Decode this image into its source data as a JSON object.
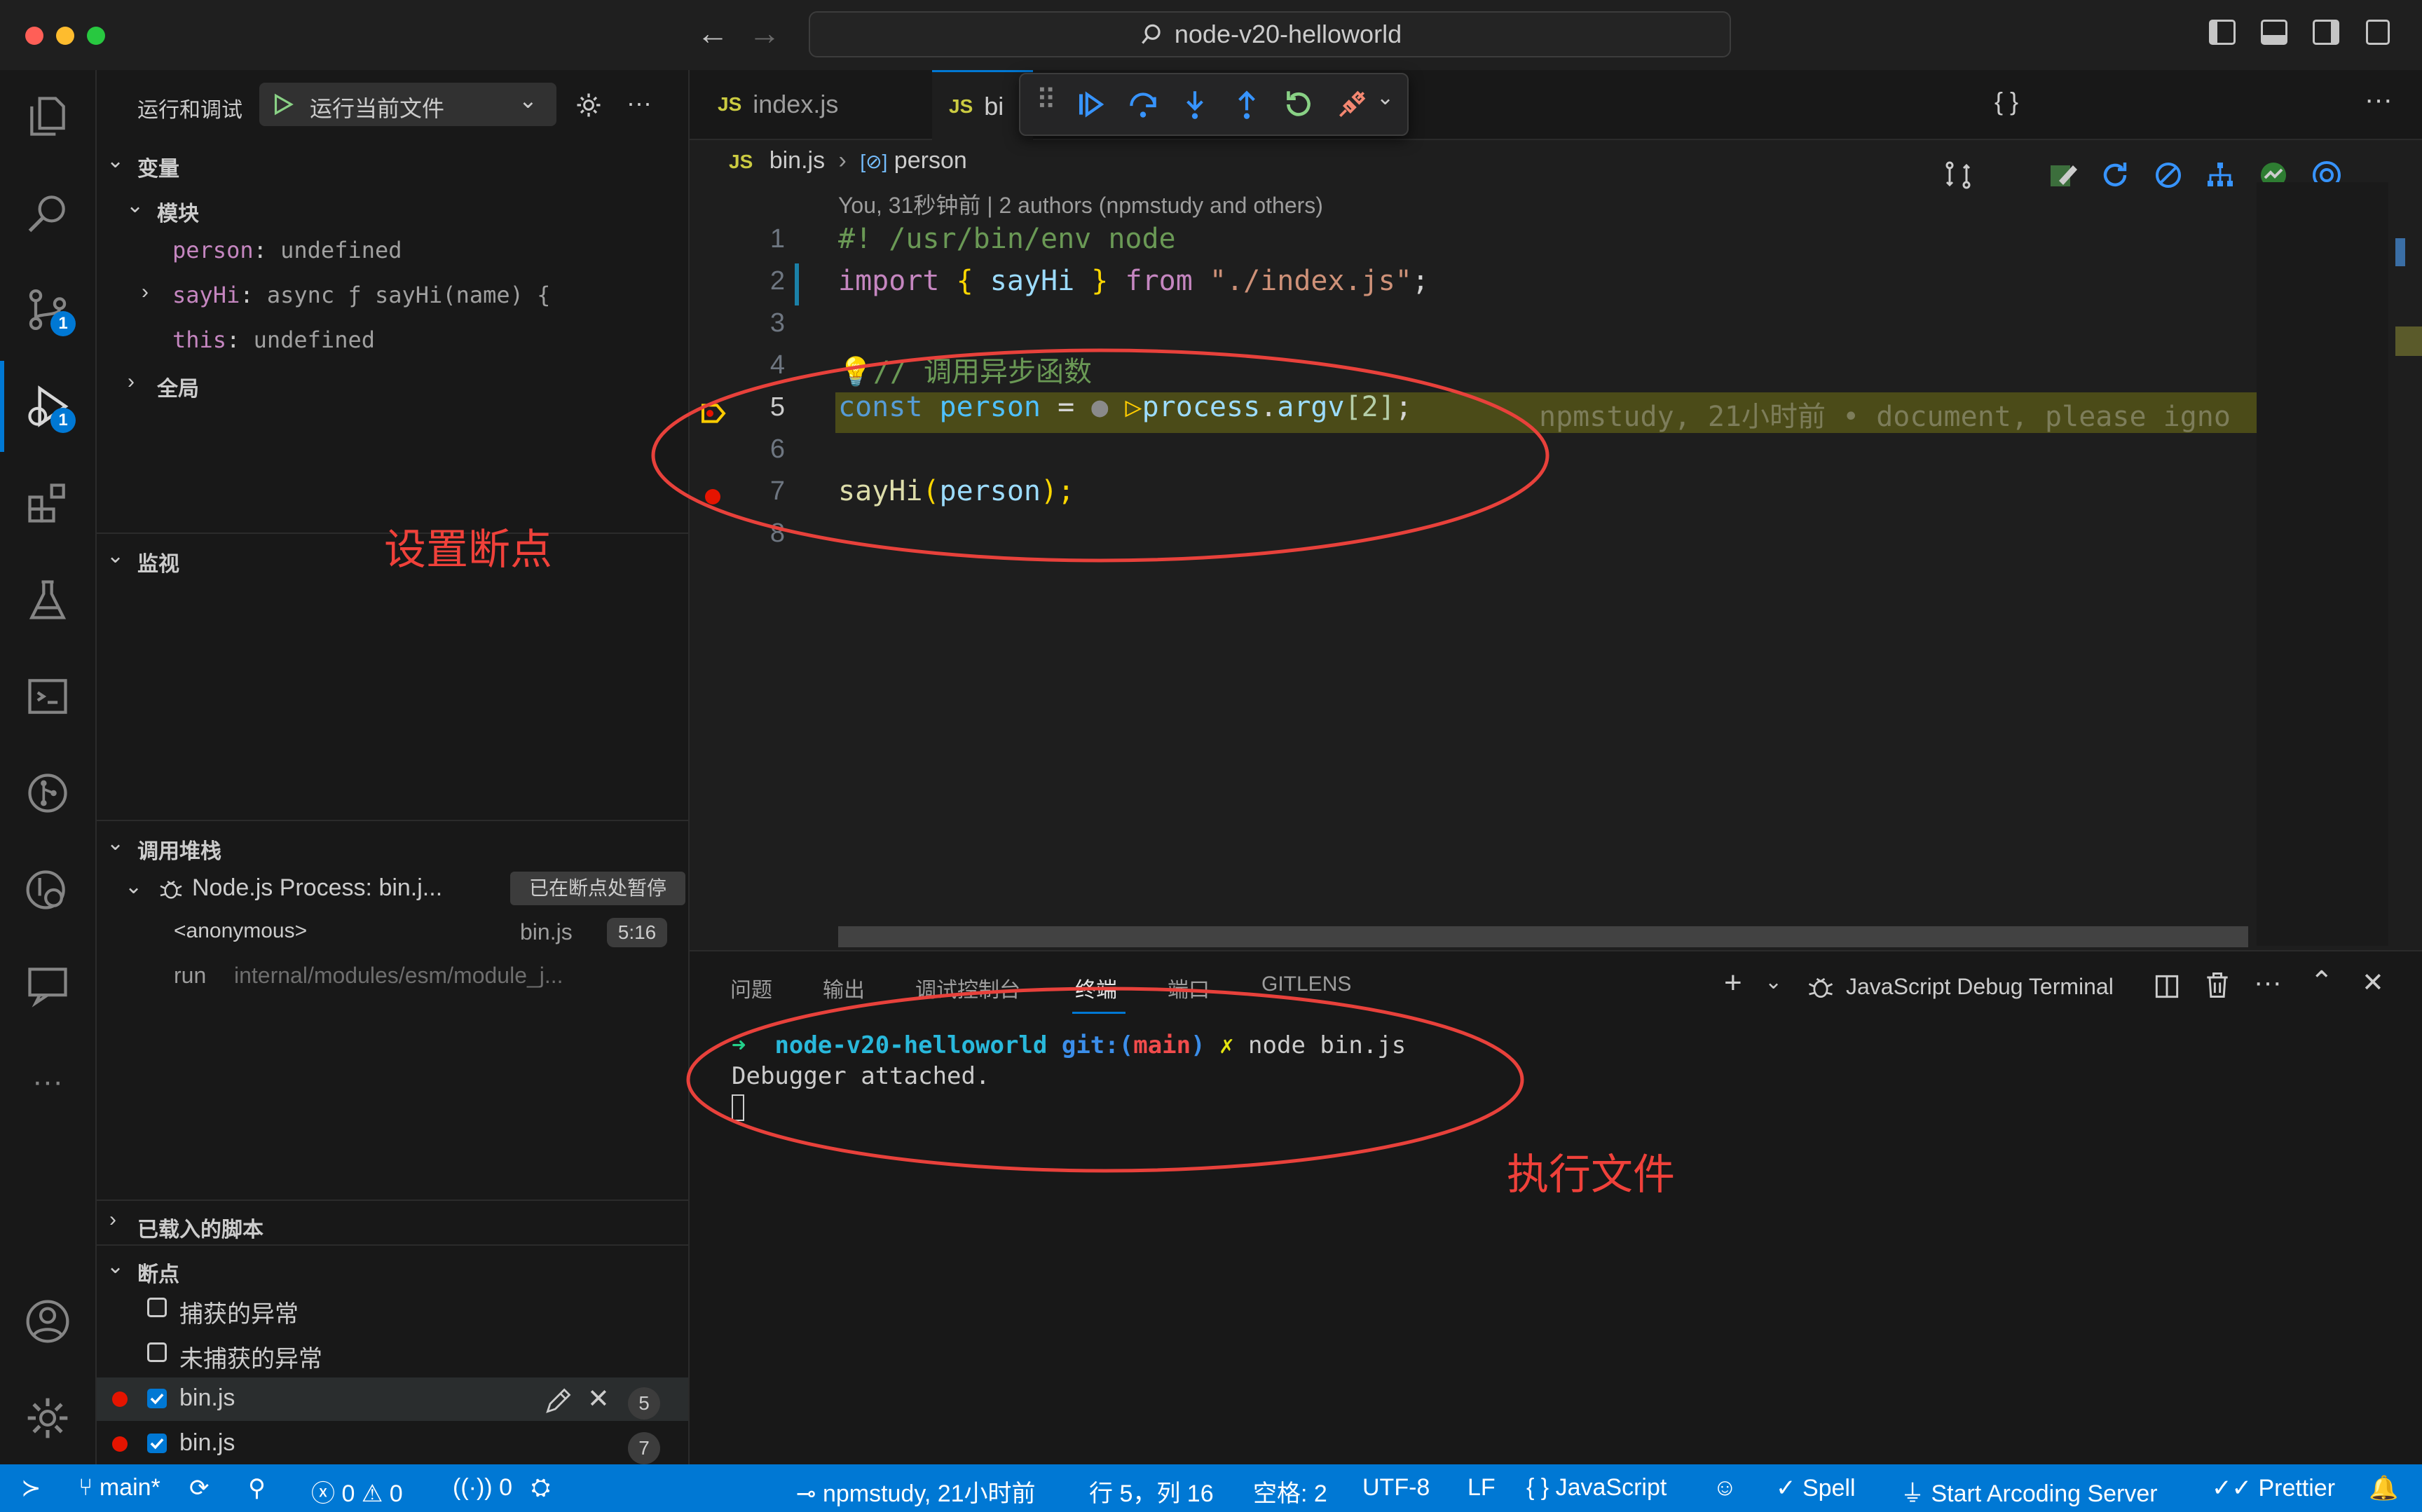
{
  "window": {
    "title": "node-v20-helloworld"
  },
  "sidebar": {
    "header": "运行和调试",
    "run_config": "运行当前文件",
    "variables": {
      "title": "变量",
      "module_group": "模块",
      "items": [
        {
          "name": "person",
          "value": "undefined"
        },
        {
          "name": "sayHi",
          "value": "async ƒ sayHi(name) {"
        },
        {
          "name": "this",
          "value": "undefined"
        }
      ],
      "global_group": "全局"
    },
    "watch_title": "监视",
    "call_stack": {
      "title": "调用堆栈",
      "process": "Node.js Process: bin.j...",
      "paused_badge": "已在断点处暂停",
      "frames": [
        {
          "name": "<anonymous>",
          "file": "bin.js",
          "pos": "5:16"
        },
        {
          "name": "run",
          "file": "internal/modules/esm/module_j..."
        }
      ]
    },
    "loaded_scripts_title": "已载入的脚本",
    "breakpoints": {
      "title": "断点",
      "caught": "捕获的异常",
      "uncaught": "未捕获的异常",
      "items": [
        {
          "file": "bin.js",
          "line": "5"
        },
        {
          "file": "bin.js",
          "line": "7"
        }
      ]
    }
  },
  "editor": {
    "tabs": [
      {
        "label": "index.js"
      },
      {
        "label": "bi"
      }
    ],
    "breadcrumb": {
      "file": "bin.js",
      "symbol": "person"
    },
    "blame_header": "You, 31秒钟前 | 2 authors (npmstudy and others)",
    "line_numbers": [
      "1",
      "2",
      "3",
      "4",
      "5",
      "6",
      "7",
      "8"
    ],
    "code": {
      "l1": "#! /usr/bin/env node",
      "l2_import": "import",
      "l2_open": "{",
      "l2_name": "sayHi",
      "l2_close": "}",
      "l2_from": "from",
      "l2_path": "\"./index.js\"",
      "l2_semi": ";",
      "l4_comment": "// 调用异步函数",
      "l5_const": "const",
      "l5_var": "person",
      "l5_eq": "=",
      "l5_obj": "process",
      "l5_prop": "argv",
      "l5_idx": "[2]",
      "l5_semi": ";",
      "l7_fn": "sayHi",
      "l7_arg": "person",
      "l7_tail": ");"
    },
    "inline_blame": "npmstudy, 21小时前 • document, please igno"
  },
  "panel": {
    "tabs": [
      "问题",
      "输出",
      "调试控制台",
      "终端",
      "端口",
      "GITLENS"
    ],
    "active_tab": "终端",
    "terminal_name": "JavaScript Debug Terminal",
    "prompt_arrow": "➜",
    "prompt_dir": "node-v20-helloworld",
    "prompt_git": "git:(",
    "prompt_branch": "main",
    "prompt_git_close": ")",
    "prompt_x": "✗",
    "command": "node bin.js",
    "output": "Debugger attached."
  },
  "statusbar": {
    "branch": "main*",
    "errors": "0",
    "warnings": "0",
    "ports": "0",
    "blame": "npmstudy, 21小时前",
    "cursor": "行 5，列 16",
    "spaces": "空格: 2",
    "encoding": "UTF-8",
    "eol": "LF",
    "language": "JavaScript",
    "spell": "Spell",
    "arcoding": "Start Arcoding Server",
    "prettier": "Prettier"
  },
  "annotations": {
    "breakpoint": "设置断点",
    "run_file": "执行文件"
  },
  "badges": {
    "scm": "1",
    "debug": "1"
  }
}
